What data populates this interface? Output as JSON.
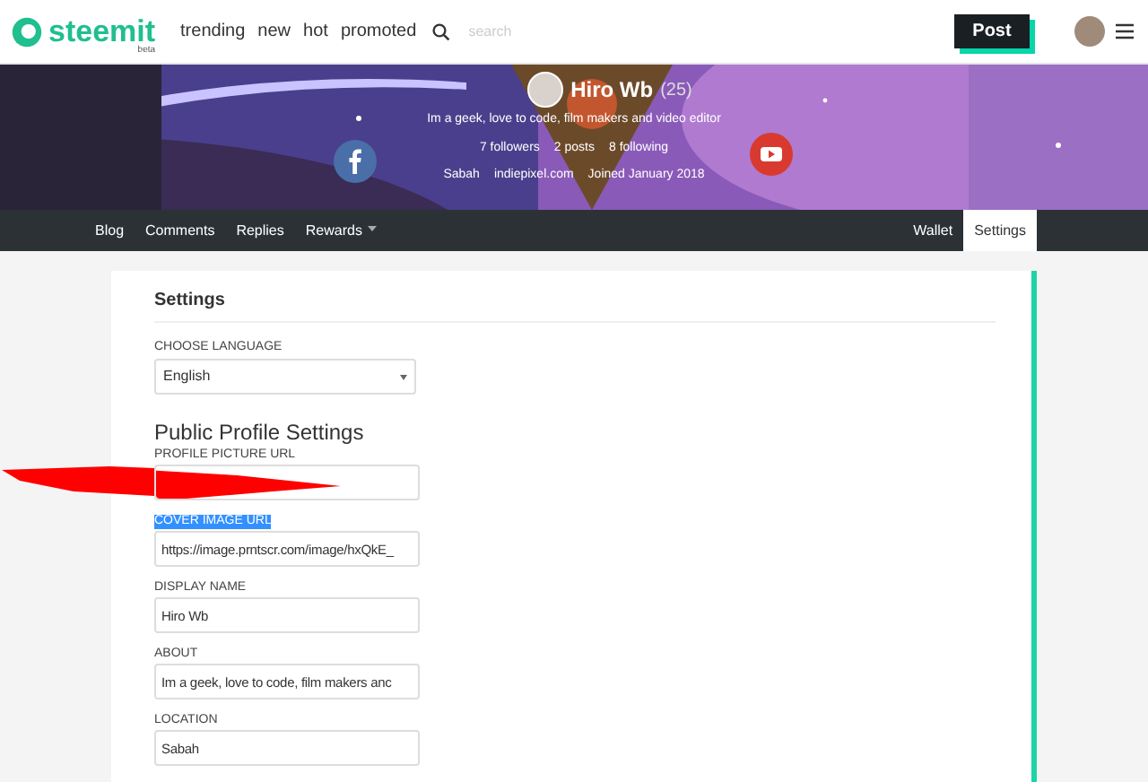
{
  "header": {
    "logo": "steemit",
    "logo_badge": "beta",
    "nav": [
      "trending",
      "new",
      "hot",
      "promoted"
    ],
    "search": {
      "placeholder": "search"
    },
    "post_button": "Post"
  },
  "profile": {
    "name": "Hiro Wb",
    "reputation": "(25)",
    "about": "Im a geek, love to code, film makers and video editor",
    "stats": [
      "7 followers",
      "2 posts",
      "8 following"
    ],
    "location": "Sabah",
    "website": "indiepixel.com",
    "joined": "Joined January 2018"
  },
  "tabs_left": [
    {
      "label": "Blog",
      "selected": false,
      "dropdown": false
    },
    {
      "label": "Comments",
      "selected": false,
      "dropdown": false
    },
    {
      "label": "Replies",
      "selected": false,
      "dropdown": false
    },
    {
      "label": "Rewards",
      "selected": false,
      "dropdown": true
    }
  ],
  "tabs_right": [
    {
      "label": "Wallet",
      "selected": false
    },
    {
      "label": "Settings",
      "selected": true
    }
  ],
  "settings": {
    "title": "Settings",
    "language": {
      "label": "CHOOSE LANGUAGE",
      "value": "English"
    },
    "section_title": "Public Profile Settings",
    "fields": [
      {
        "label": "PROFILE PICTURE URL",
        "label_selected": false,
        "redacted": true
      },
      {
        "label": "COVER IMAGE URL",
        "label_selected": true,
        "value": "https://image.prntscr.com/image/hxQkE_"
      },
      {
        "label": "DISPLAY NAME",
        "label_selected": false,
        "value": "Hiro Wb"
      },
      {
        "label": "ABOUT",
        "label_selected": false,
        "value": "Im a geek, love to code, film makers anc"
      },
      {
        "label": "LOCATION",
        "label_selected": false,
        "value": "Sabah"
      }
    ]
  }
}
